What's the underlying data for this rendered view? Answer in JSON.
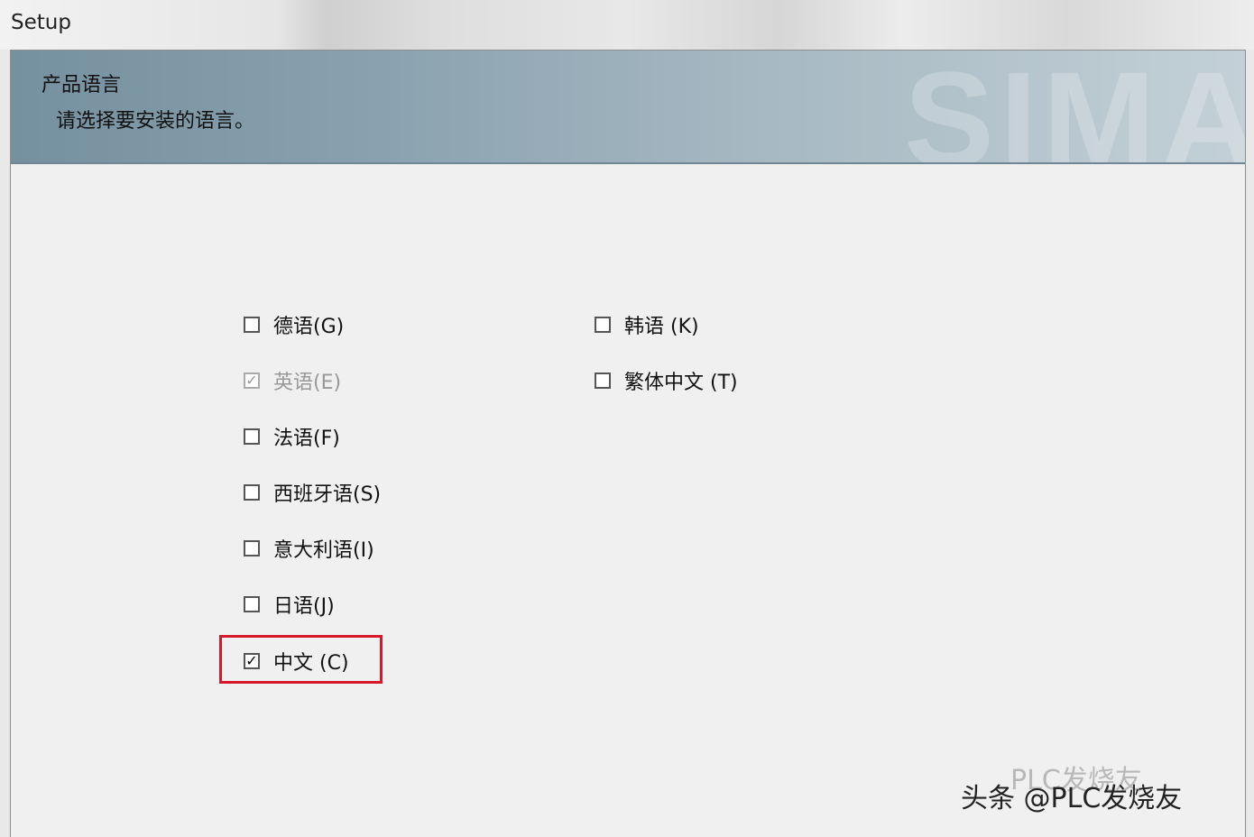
{
  "window": {
    "title": "Setup"
  },
  "banner": {
    "heading": "产品语言",
    "subheading": "请选择要安装的语言。",
    "brand_watermark": "SIMA"
  },
  "languages_left": [
    {
      "label": "德语(G)",
      "checked": false,
      "enabled": true
    },
    {
      "label": "英语(E)",
      "checked": true,
      "enabled": false
    },
    {
      "label": "法语(F)",
      "checked": false,
      "enabled": true
    },
    {
      "label": "西班牙语(S)",
      "checked": false,
      "enabled": true
    },
    {
      "label": "意大利语(I)",
      "checked": false,
      "enabled": true
    },
    {
      "label": "日语(J)",
      "checked": false,
      "enabled": true
    },
    {
      "label": "中文 (C)",
      "checked": true,
      "enabled": true
    }
  ],
  "languages_right": [
    {
      "label": "韩语 (K)",
      "checked": false,
      "enabled": true
    },
    {
      "label": "繁体中文 (T)",
      "checked": false,
      "enabled": true
    }
  ],
  "highlight_color": "#d6182a",
  "footer": {
    "watermark": "头条 @PLC发烧友",
    "watermark_faint": "PLC发烧友"
  }
}
